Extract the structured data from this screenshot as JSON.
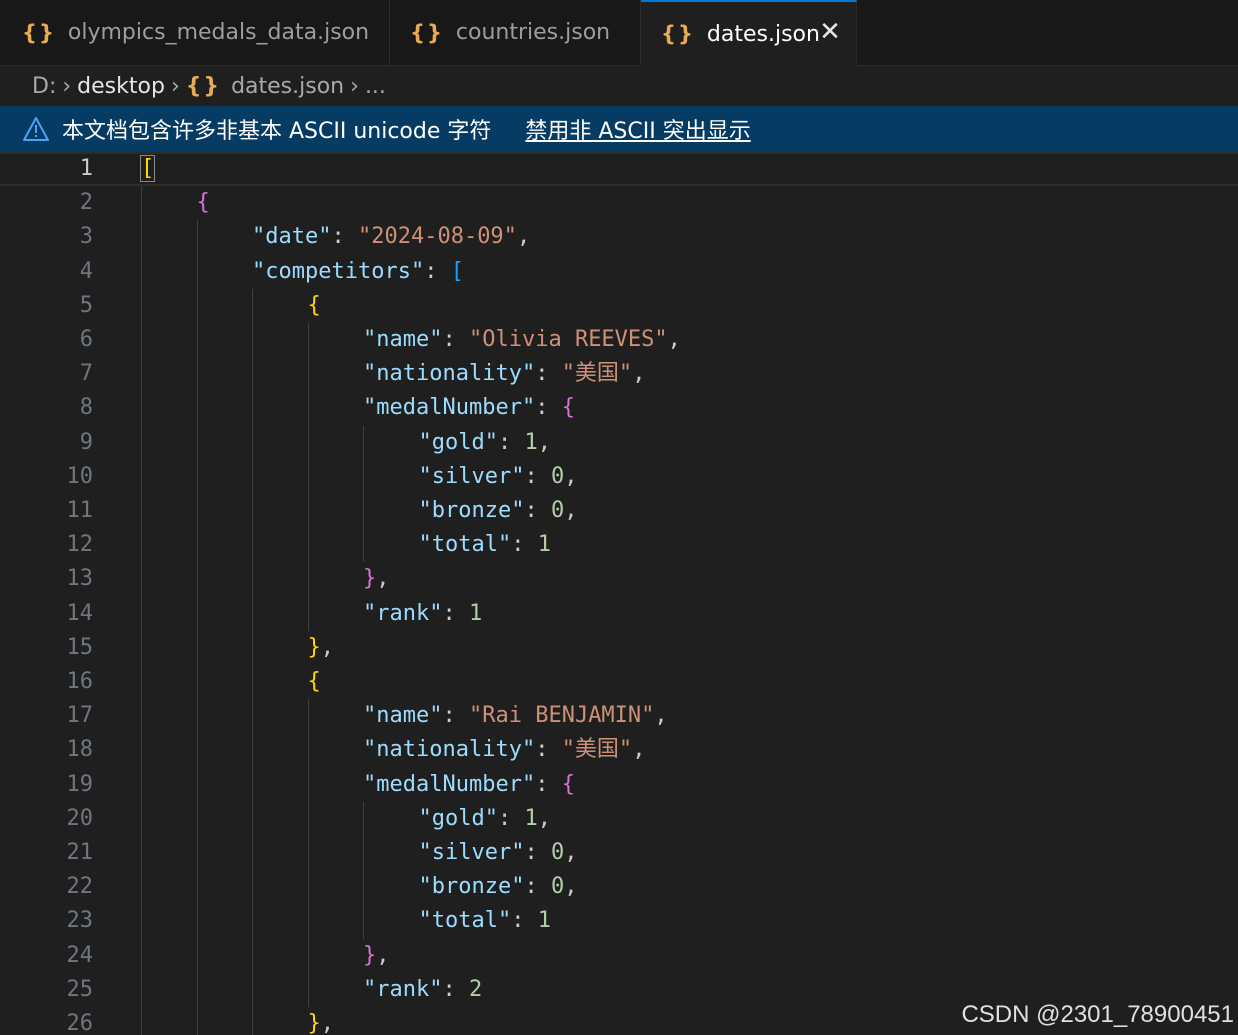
{
  "tabs": [
    {
      "label": "olympics_medals_data.json",
      "icon": "json-braces-icon",
      "active": false
    },
    {
      "label": "countries.json",
      "icon": "json-braces-icon",
      "active": false
    },
    {
      "label": "dates.json",
      "icon": "json-braces-icon",
      "active": true
    }
  ],
  "tab_icon_glyph": "{}",
  "close_glyph": "✕",
  "breadcrumb": {
    "drive": "D:",
    "folder": "desktop",
    "file": "dates.json",
    "more": "..."
  },
  "banner": {
    "message": "本文档包含许多非基本 ASCII unicode 字符",
    "action": "禁用非 ASCII 突出显示"
  },
  "editor": {
    "active_line": 1,
    "lines": [
      {
        "num": "1",
        "indent": 0,
        "tokens": [
          [
            "b1",
            "["
          ]
        ]
      },
      {
        "num": "2",
        "indent": 1,
        "tokens": [
          [
            "b2",
            "{"
          ]
        ]
      },
      {
        "num": "3",
        "indent": 2,
        "tokens": [
          [
            "k",
            "\"date\""
          ],
          [
            "p",
            ": "
          ],
          [
            "s",
            "\"2024-08-09\""
          ],
          [
            "p",
            ","
          ]
        ]
      },
      {
        "num": "4",
        "indent": 2,
        "tokens": [
          [
            "k",
            "\"competitors\""
          ],
          [
            "p",
            ": "
          ],
          [
            "b3",
            "["
          ]
        ]
      },
      {
        "num": "5",
        "indent": 3,
        "tokens": [
          [
            "b1",
            "{"
          ]
        ]
      },
      {
        "num": "6",
        "indent": 4,
        "tokens": [
          [
            "k",
            "\"name\""
          ],
          [
            "p",
            ": "
          ],
          [
            "s",
            "\"Olivia REEVES\""
          ],
          [
            "p",
            ","
          ]
        ]
      },
      {
        "num": "7",
        "indent": 4,
        "tokens": [
          [
            "k",
            "\"nationality\""
          ],
          [
            "p",
            ": "
          ],
          [
            "s",
            "\"美国\""
          ],
          [
            "p",
            ","
          ]
        ]
      },
      {
        "num": "8",
        "indent": 4,
        "tokens": [
          [
            "k",
            "\"medalNumber\""
          ],
          [
            "p",
            ": "
          ],
          [
            "b2",
            "{"
          ]
        ]
      },
      {
        "num": "9",
        "indent": 5,
        "tokens": [
          [
            "k",
            "\"gold\""
          ],
          [
            "p",
            ": "
          ],
          [
            "n",
            "1"
          ],
          [
            "p",
            ","
          ]
        ]
      },
      {
        "num": "10",
        "indent": 5,
        "tokens": [
          [
            "k",
            "\"silver\""
          ],
          [
            "p",
            ": "
          ],
          [
            "n",
            "0"
          ],
          [
            "p",
            ","
          ]
        ]
      },
      {
        "num": "11",
        "indent": 5,
        "tokens": [
          [
            "k",
            "\"bronze\""
          ],
          [
            "p",
            ": "
          ],
          [
            "n",
            "0"
          ],
          [
            "p",
            ","
          ]
        ]
      },
      {
        "num": "12",
        "indent": 5,
        "tokens": [
          [
            "k",
            "\"total\""
          ],
          [
            "p",
            ": "
          ],
          [
            "n",
            "1"
          ]
        ]
      },
      {
        "num": "13",
        "indent": 4,
        "tokens": [
          [
            "b2",
            "}"
          ],
          [
            "p",
            ","
          ]
        ]
      },
      {
        "num": "14",
        "indent": 4,
        "tokens": [
          [
            "k",
            "\"rank\""
          ],
          [
            "p",
            ": "
          ],
          [
            "n",
            "1"
          ]
        ]
      },
      {
        "num": "15",
        "indent": 3,
        "tokens": [
          [
            "b1",
            "}"
          ],
          [
            "p",
            ","
          ]
        ]
      },
      {
        "num": "16",
        "indent": 3,
        "tokens": [
          [
            "b1",
            "{"
          ]
        ]
      },
      {
        "num": "17",
        "indent": 4,
        "tokens": [
          [
            "k",
            "\"name\""
          ],
          [
            "p",
            ": "
          ],
          [
            "s",
            "\"Rai BENJAMIN\""
          ],
          [
            "p",
            ","
          ]
        ]
      },
      {
        "num": "18",
        "indent": 4,
        "tokens": [
          [
            "k",
            "\"nationality\""
          ],
          [
            "p",
            ": "
          ],
          [
            "s",
            "\"美国\""
          ],
          [
            "p",
            ","
          ]
        ]
      },
      {
        "num": "19",
        "indent": 4,
        "tokens": [
          [
            "k",
            "\"medalNumber\""
          ],
          [
            "p",
            ": "
          ],
          [
            "b2",
            "{"
          ]
        ]
      },
      {
        "num": "20",
        "indent": 5,
        "tokens": [
          [
            "k",
            "\"gold\""
          ],
          [
            "p",
            ": "
          ],
          [
            "n",
            "1"
          ],
          [
            "p",
            ","
          ]
        ]
      },
      {
        "num": "21",
        "indent": 5,
        "tokens": [
          [
            "k",
            "\"silver\""
          ],
          [
            "p",
            ": "
          ],
          [
            "n",
            "0"
          ],
          [
            "p",
            ","
          ]
        ]
      },
      {
        "num": "22",
        "indent": 5,
        "tokens": [
          [
            "k",
            "\"bronze\""
          ],
          [
            "p",
            ": "
          ],
          [
            "n",
            "0"
          ],
          [
            "p",
            ","
          ]
        ]
      },
      {
        "num": "23",
        "indent": 5,
        "tokens": [
          [
            "k",
            "\"total\""
          ],
          [
            "p",
            ": "
          ],
          [
            "n",
            "1"
          ]
        ]
      },
      {
        "num": "24",
        "indent": 4,
        "tokens": [
          [
            "b2",
            "}"
          ],
          [
            "p",
            ","
          ]
        ]
      },
      {
        "num": "25",
        "indent": 4,
        "tokens": [
          [
            "k",
            "\"rank\""
          ],
          [
            "p",
            ": "
          ],
          [
            "n",
            "2"
          ]
        ]
      },
      {
        "num": "26",
        "indent": 3,
        "tokens": [
          [
            "b1",
            "}"
          ],
          [
            "p",
            ","
          ]
        ]
      }
    ]
  },
  "watermark": "CSDN @2301_78900451",
  "colors": {
    "accent": "#0078d4",
    "banner_bg": "#063b64",
    "json_key": "#9cdcfe",
    "json_string": "#ce9178",
    "json_number": "#b5cea8",
    "bracket_gold": "#ffd700",
    "bracket_orchid": "#da70d6",
    "bracket_blue": "#179fff",
    "icon_braces": "#e8ab53"
  }
}
